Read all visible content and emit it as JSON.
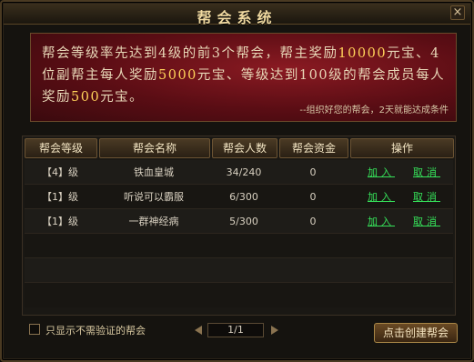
{
  "window": {
    "title": "帮会系统",
    "close_label": "×"
  },
  "banner": {
    "line1_a": "帮会等级率先达到4级的前3个帮会，帮主奖励",
    "line1_hl": "10000",
    "line1_b": "元宝、4位副帮主每人奖励",
    "line2_hl": "5000",
    "line2_b": "元宝、等级达到100级的帮会成员每人奖励",
    "line3_hl": "500",
    "line3_b": "元宝。",
    "note": "--组织好您的帮会，2天就能达成条件"
  },
  "table": {
    "headers": [
      "帮会等级",
      "帮会名称",
      "帮会人数",
      "帮会资金",
      "操作"
    ],
    "rows": [
      {
        "level": "【4】级",
        "name": "铁血皇城",
        "members": "34/240",
        "funds": "0",
        "join": "加入",
        "cancel": "取消"
      },
      {
        "level": "【1】级",
        "name": "听说可以霸服",
        "members": "6/300",
        "funds": "0",
        "join": "加入",
        "cancel": "取消"
      },
      {
        "level": "【1】级",
        "name": "一群神经病",
        "members": "5/300",
        "funds": "0",
        "join": "加入",
        "cancel": "取消"
      }
    ]
  },
  "footer": {
    "filter_label": "只显示不需验证的帮会",
    "page_indicator": "1/1",
    "create_button": "点击创建帮会"
  }
}
